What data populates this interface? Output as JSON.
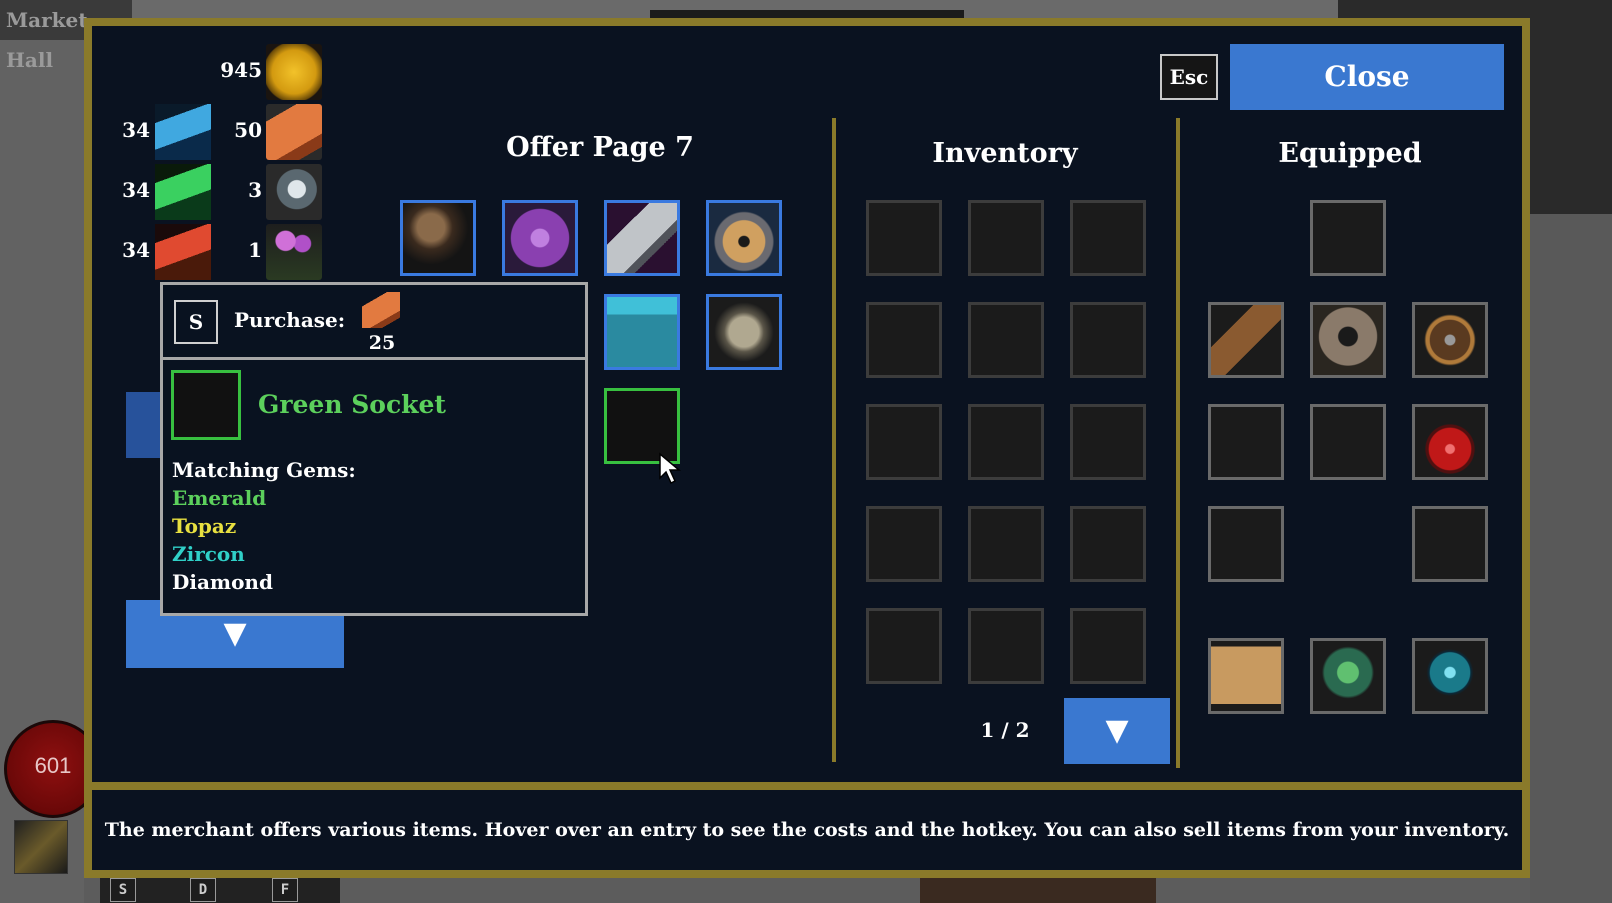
{
  "background": {
    "market_label": "Market Hall",
    "health_value": "601",
    "hotkeys": [
      "S",
      "D",
      "F"
    ]
  },
  "window": {
    "esc_label": "Esc",
    "close_label": "Close"
  },
  "resources": {
    "gold": "945",
    "brick": "50",
    "disc": "3",
    "flower": "1",
    "blue_gem": "34",
    "green_gem": "34",
    "red_gem": "34"
  },
  "offer": {
    "title": "Offer Page 7",
    "items": [
      {
        "name": "staff",
        "icon": "staff-icon"
      },
      {
        "name": "spellbook",
        "icon": "spellbook-icon"
      },
      {
        "name": "stone-slab",
        "icon": "stone-slab-icon"
      },
      {
        "name": "helmet",
        "icon": "helmet-icon"
      },
      {
        "name": "robe",
        "icon": "robe-icon"
      },
      {
        "name": "gauntlet",
        "icon": "gauntlet-icon"
      },
      {
        "name": "green-socket",
        "icon": "green-socket-icon"
      }
    ],
    "down_arrow": "▼"
  },
  "tooltip": {
    "hotkey": "S",
    "purchase_label": "Purchase:",
    "cost": "25",
    "item_name": "Green Socket",
    "matching_label": "Matching Gems:",
    "gems": [
      {
        "name": "Emerald",
        "color": "#5cd05c"
      },
      {
        "name": "Topaz",
        "color": "#e8e040"
      },
      {
        "name": "Zircon",
        "color": "#30d0c8"
      },
      {
        "name": "Diamond",
        "color": "#ffffff"
      }
    ]
  },
  "inventory": {
    "title": "Inventory",
    "page": "1 / 2",
    "down_arrow": "▼"
  },
  "equipped": {
    "title": "Equipped"
  },
  "footer": {
    "text": "The merchant offers various items. Hover over an entry to see the costs and the hotkey. You can also sell items from your inventory."
  }
}
